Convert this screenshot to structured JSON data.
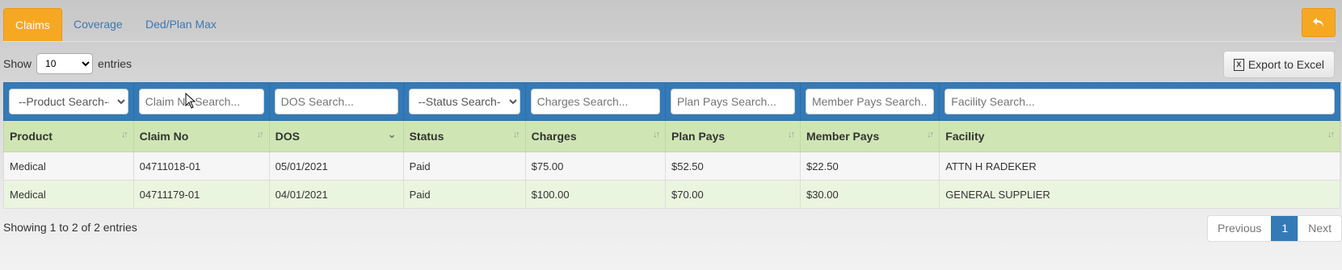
{
  "tabs": [
    {
      "label": "Claims",
      "active": true
    },
    {
      "label": "Coverage",
      "active": false
    },
    {
      "label": "Ded/Plan Max",
      "active": false
    }
  ],
  "back_button_icon": "undo-arrow-icon",
  "length_control": {
    "prefix": "Show",
    "selected": "10",
    "suffix": "entries"
  },
  "export_button": {
    "label": "Export to Excel",
    "icon": "excel-file-icon"
  },
  "filters": {
    "product": "--Product Search--",
    "claim_no": "Claim No Search...",
    "dos": "DOS Search...",
    "status": "--Status Search--",
    "charges": "Charges Search...",
    "plan_pays": "Plan Pays Search...",
    "member_pays": "Member Pays Search...",
    "facility": "Facility Search..."
  },
  "columns": [
    "Product",
    "Claim No",
    "DOS",
    "Status",
    "Charges",
    "Plan Pays",
    "Member Pays",
    "Facility"
  ],
  "rows": [
    [
      "Medical",
      "04711018-01",
      "05/01/2021",
      "Paid",
      "$75.00",
      "$52.50",
      "$22.50",
      "ATTN H RADEKER"
    ],
    [
      "Medical",
      "04711179-01",
      "04/01/2021",
      "Paid",
      "$100.00",
      "$70.00",
      "$30.00",
      "GENERAL SUPPLIER"
    ]
  ],
  "info": "Showing 1 to 2 of 2 entries",
  "pagination": {
    "previous": "Previous",
    "current": "1",
    "next": "Next"
  },
  "colors": {
    "tab_active": "#f7a823",
    "filter_bar": "#337ab7",
    "header_bg": "#cfe6b4",
    "even_row": "#eaf5df"
  }
}
